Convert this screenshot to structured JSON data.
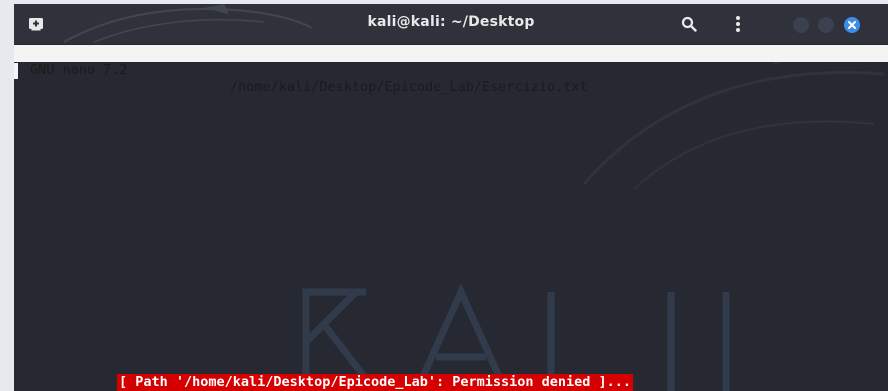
{
  "window": {
    "title": "kali@kali: ~/Desktop",
    "icons": {
      "new_tab": "new-tab-icon",
      "search": "search-icon",
      "menu": "kebab-menu-icon",
      "minimize": "minimize-icon",
      "maximize": "maximize-icon",
      "close": "close-icon"
    },
    "colors": {
      "titlebar": "#2f323a",
      "terminal_bg": "#262931",
      "close_button": "#3d8de8",
      "status_bg": "#d70000"
    }
  },
  "nano": {
    "version": "GNU nano 7.2",
    "file_path": "/home/kali/Desktop/Epicode_Lab/Esercizio.txt",
    "status_message": "[ Path '/home/kali/Desktop/Epicode_Lab': Permission denied ]..."
  },
  "watermark": {
    "text": "KALI"
  }
}
